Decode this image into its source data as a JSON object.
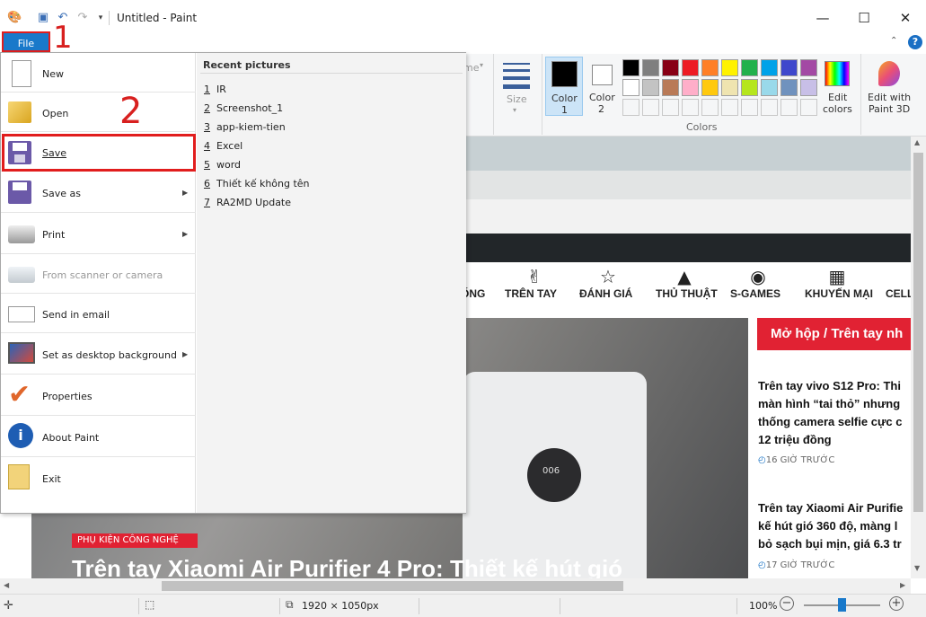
{
  "window": {
    "title": "Untitled - Paint",
    "minimize": "—",
    "maximize": "☐",
    "close": "✕"
  },
  "file_button": "File",
  "annotations": [
    "1",
    "2"
  ],
  "ribbon": {
    "ime_label": "me",
    "size_label": "Size",
    "color1_label": "Color\n1",
    "color1a": "Color",
    "color1b": "1",
    "color2a": "Color",
    "color2b": "2",
    "colors_group": "Colors",
    "edit_colors_a": "Edit",
    "edit_colors_b": "colors",
    "paint3d_a": "Edit with",
    "paint3d_b": "Paint 3D",
    "palette_row1": [
      "#000000",
      "#7f7f7f",
      "#880015",
      "#ed1c24",
      "#ff7f27",
      "#fff200",
      "#22b14c",
      "#00a2e8",
      "#3f48cc",
      "#a349a4"
    ],
    "palette_row2": [
      "#ffffff",
      "#c3c3c3",
      "#b97a57",
      "#ffaec9",
      "#ffc90e",
      "#efe4b0",
      "#b5e61d",
      "#99d9ea",
      "#7092be",
      "#c8bfe7"
    ]
  },
  "menu": {
    "items": [
      {
        "label": "New",
        "icon": "new-document-icon"
      },
      {
        "label": "Open",
        "icon": "open-folder-icon"
      },
      {
        "label": "Save",
        "icon": "save-disk-icon"
      },
      {
        "label": "Save as",
        "icon": "save-as-icon"
      },
      {
        "label": "Print",
        "icon": "printer-icon"
      },
      {
        "label": "From scanner or camera",
        "icon": "scanner-icon"
      },
      {
        "label": "Send in email",
        "icon": "email-icon"
      },
      {
        "label": "Set as desktop background",
        "icon": "desktop-icon"
      },
      {
        "label": "Properties",
        "icon": "checkmark-icon"
      },
      {
        "label": "About Paint",
        "icon": "info-icon"
      },
      {
        "label": "Exit",
        "icon": "exit-icon"
      }
    ],
    "recent_title": "Recent pictures",
    "recent": [
      {
        "n": "1",
        "name": "IR"
      },
      {
        "n": "2",
        "name": "Screenshot_1"
      },
      {
        "n": "3",
        "name": "app-kiem-tien"
      },
      {
        "n": "4",
        "name": "Excel"
      },
      {
        "n": "5",
        "name": "word"
      },
      {
        "n": "6",
        "name": "Thiết kế không tên"
      },
      {
        "n": "7",
        "name": "RA2MD Update"
      }
    ]
  },
  "canvas": {
    "nav": [
      "ỐNG",
      "TRÊN TAY",
      "ĐÁNH GIÁ",
      "THỦ THUẬT",
      "S-GAMES",
      "KHUYẾN MẠI",
      "CELL"
    ],
    "red_banner": "Mở hộp / Trên tay nh",
    "article1": [
      "Trên tay vivo S12 Pro: Thi",
      "màn hình “tai thỏ” nhưng",
      "thống camera selfie cực c",
      "12 triệu đồng"
    ],
    "time1": "16 GIỜ TRƯỚC",
    "article2": [
      "Trên tay Xiaomi Air Purifie",
      "kế hút gió 360 độ, màng l",
      "bỏ sạch bụi mịn, giá 6.3 tr"
    ],
    "time2": "17 GIỜ TRƯỚC",
    "tag": "PHỤ KIỆN CÔNG NGHỆ",
    "headline": "Trên tay Xiaomi Air Purifier 4 Pro: Thiết kế hút gió",
    "device_display": "006"
  },
  "status": {
    "dimensions": "1920 × 1050px",
    "zoom": "100%"
  },
  "help": "?"
}
